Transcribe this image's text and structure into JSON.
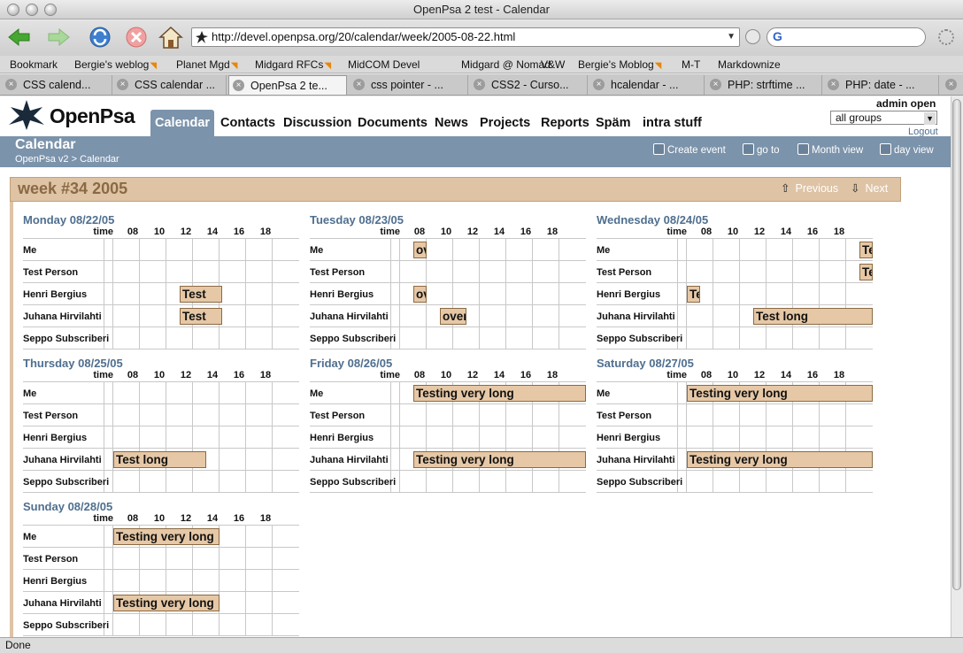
{
  "window": {
    "title": "OpenPsa 2 test - Calendar"
  },
  "toolbar": {
    "url": "http://devel.openpsa.org/20/calendar/week/2005-08-22.html",
    "search_placeholder": ""
  },
  "bookmarks": [
    {
      "label": "Bookmark",
      "rss": false
    },
    {
      "label": "Bergie's weblog",
      "rss": true
    },
    {
      "label": "Planet Mgd",
      "rss": true
    },
    {
      "label": "Midgard RFCs",
      "rss": true
    },
    {
      "label": "MidCOM Devel",
      "rss": false
    },
    {
      "label": "Midgard @ Nomad",
      "rss": false
    },
    {
      "label": "V&W",
      "rss": false
    },
    {
      "label": "Bergie's Moblog",
      "rss": true
    },
    {
      "label": "M-T",
      "rss": false
    },
    {
      "label": "Markdownize",
      "rss": false
    }
  ],
  "tabs": [
    {
      "label": "CSS calend...",
      "active": false,
      "icon": "globe-icon"
    },
    {
      "label": "CSS calendar ...",
      "active": false,
      "icon": "globe-icon"
    },
    {
      "label": "OpenPsa 2 te...",
      "active": true,
      "icon": "openpsa-icon"
    },
    {
      "label": "css pointer - ...",
      "active": false,
      "icon": "google-icon"
    },
    {
      "label": "CSS2 - Curso...",
      "active": false,
      "icon": "globe-icon"
    },
    {
      "label": "hcalendar - ...",
      "active": false,
      "icon": "leaf-icon"
    },
    {
      "label": "PHP: strftime ...",
      "active": false,
      "icon": "php-icon"
    },
    {
      "label": "PHP: date - ...",
      "active": false,
      "icon": "php-icon"
    }
  ],
  "status": "Done",
  "app": {
    "logo": "OpenPsa",
    "nav": [
      {
        "label": "Calendar",
        "active": true
      },
      {
        "label": "Contacts",
        "active": false
      },
      {
        "label": "Discussion",
        "active": false
      },
      {
        "label": "Documents",
        "active": false
      },
      {
        "label": "News",
        "active": false
      },
      {
        "label": "Projects",
        "active": false
      },
      {
        "label": "Reports",
        "active": false
      },
      {
        "label": "Späm",
        "active": false
      },
      {
        "label": "intra stuff",
        "active": false
      }
    ],
    "user": "admin open",
    "group_select": "all groups",
    "logout": "Logout",
    "page_title": "Calendar",
    "breadcrumb": "OpenPsa v2 > Calendar",
    "actions": [
      "Create event",
      "go to",
      "Month view",
      "day view"
    ]
  },
  "week": {
    "title": "week #34 2005",
    "previous": "Previous",
    "next": "Next",
    "time_label": "time",
    "hours": [
      "08",
      "10",
      "12",
      "14",
      "16",
      "18"
    ],
    "people": [
      "Me",
      "Test Person",
      "Henri Bergius",
      "Juhana Hirvilahti",
      "Seppo Subscriberi"
    ],
    "days": [
      {
        "label": "Monday 08/22/05",
        "events": [
          {
            "person": 2,
            "text": "Test"
          },
          {
            "person": 3,
            "text": "Test"
          }
        ]
      },
      {
        "label": "Tuesday 08/23/05",
        "events": [
          {
            "person": 0,
            "text": "ov"
          },
          {
            "person": 2,
            "text": "ov"
          },
          {
            "person": 3,
            "text": "over"
          }
        ]
      },
      {
        "label": "Wednesday 08/24/05",
        "events": [
          {
            "person": 0,
            "text": "Te"
          },
          {
            "person": 1,
            "text": "Te"
          },
          {
            "person": 2,
            "text": "Te"
          },
          {
            "person": 3,
            "text": "Test long"
          }
        ]
      },
      {
        "label": "Thursday 08/25/05",
        "events": [
          {
            "person": 3,
            "text": "Test long"
          }
        ]
      },
      {
        "label": "Friday 08/26/05",
        "events": [
          {
            "person": 0,
            "text": "Testing very long"
          },
          {
            "person": 3,
            "text": "Testing very long"
          }
        ]
      },
      {
        "label": "Saturday 08/27/05",
        "events": [
          {
            "person": 0,
            "text": "Testing very long"
          },
          {
            "person": 3,
            "text": "Testing very long"
          }
        ]
      },
      {
        "label": "Sunday 08/28/05",
        "events": [
          {
            "person": 0,
            "text": "Testing very long"
          },
          {
            "person": 3,
            "text": "Testing very long"
          }
        ]
      }
    ]
  }
}
